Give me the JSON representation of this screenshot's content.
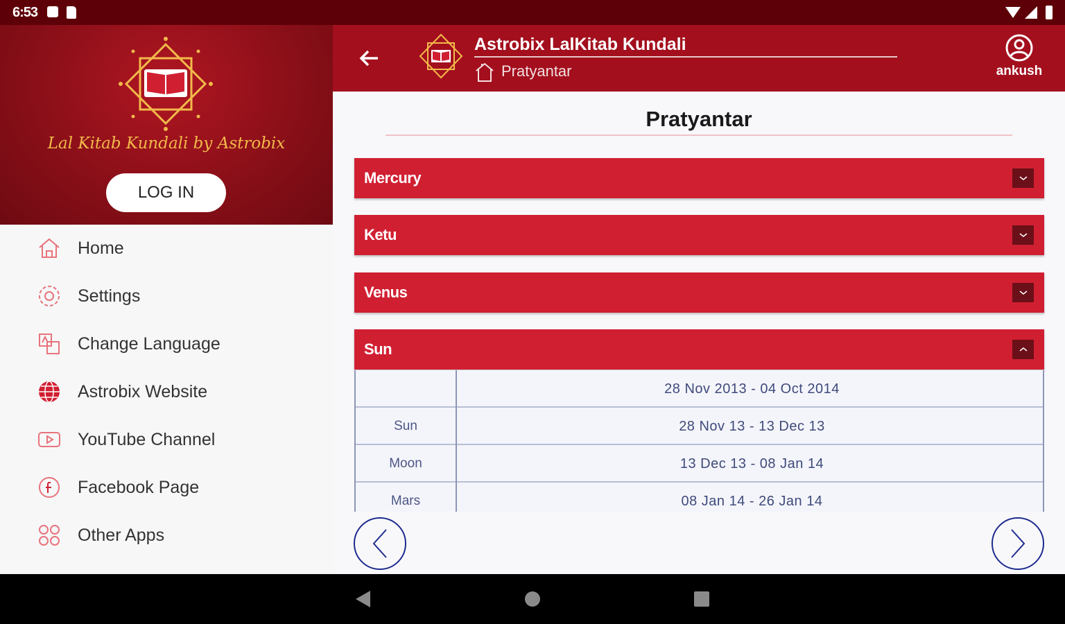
{
  "status": {
    "time": "6:53"
  },
  "drawer": {
    "brand": "Lal Kitab Kundali by Astrobix",
    "login_label": "LOG IN",
    "items": [
      {
        "label": "Home",
        "icon": "home-icon"
      },
      {
        "label": "Settings",
        "icon": "gear-icon"
      },
      {
        "label": "Change Language",
        "icon": "translate-icon"
      },
      {
        "label": "Astrobix Website",
        "icon": "globe-icon"
      },
      {
        "label": "YouTube Channel",
        "icon": "youtube-icon"
      },
      {
        "label": "Facebook Page",
        "icon": "facebook-icon"
      },
      {
        "label": "Other Apps",
        "icon": "apps-grid-icon"
      }
    ]
  },
  "app_bar": {
    "title": "Astrobix LalKitab Kundali",
    "subtitle": "Pratyantar",
    "user": "ankush"
  },
  "page": {
    "title": "Pratyantar",
    "sections": [
      {
        "label": "Mercury",
        "expanded": false
      },
      {
        "label": "Ketu",
        "expanded": false
      },
      {
        "label": "Venus",
        "expanded": false
      },
      {
        "label": "Sun",
        "expanded": true
      }
    ],
    "table": {
      "header_range": "28 Nov 2013 - 04 Oct 2014",
      "rows": [
        {
          "planet": "Sun",
          "range": "28 Nov 13 - 13 Dec 13"
        },
        {
          "planet": "Moon",
          "range": "13 Dec 13 - 08 Jan 14"
        },
        {
          "planet": "Mars",
          "range": "08 Jan 14 - 26 Jan 14"
        }
      ]
    }
  },
  "colors": {
    "status_bar": "#5e0008",
    "app_bar": "#a30f1d",
    "accordion": "#d11f32",
    "accordion_toggle": "#6b0f18",
    "brand_gold": "#f2b94a",
    "nav_circle": "#1e2b8e"
  }
}
